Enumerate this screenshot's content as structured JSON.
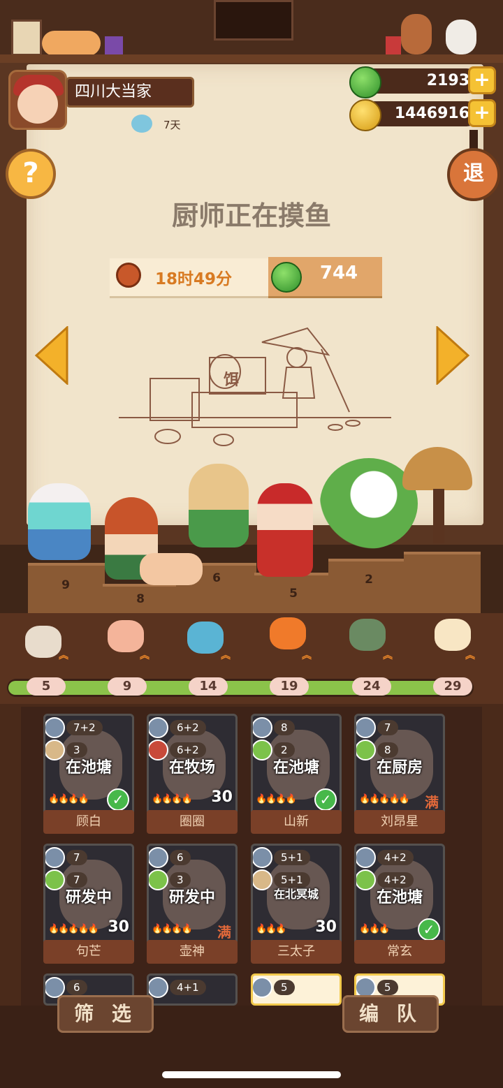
{
  "player": {
    "name": "四川大当家",
    "days": "7天"
  },
  "currency": {
    "jade": "2193",
    "coins": "1446916",
    "plus": "+"
  },
  "buttons": {
    "help": "?",
    "exit": "退",
    "filter": "筛 选",
    "team": "编 队"
  },
  "status": {
    "title": "厨师正在摸鱼",
    "timer": "18时49分",
    "reward": "744"
  },
  "sketch_sign": "饵",
  "stage_steps": [
    "9",
    "8",
    "6",
    "5",
    "2"
  ],
  "ingredient_levels": [
    "5",
    "9",
    "14",
    "19",
    "24",
    "29"
  ],
  "ingredients": [
    "shell-icon",
    "shrimp-icon",
    "fish-icon",
    "goldfish-icon",
    "crab-icon",
    "fin-icon"
  ],
  "cards": [
    {
      "name": "顾白",
      "fish": "7+2",
      "skill": "3",
      "status": "在池塘",
      "flames": "🔥🔥🔥🔥",
      "num": "",
      "check": true,
      "full": ""
    },
    {
      "name": "圈圈",
      "fish": "6+2",
      "skill": "6+2",
      "status": "在牧场",
      "flames": "🔥🔥🔥🔥",
      "num": "30",
      "check": false,
      "full": ""
    },
    {
      "name": "山新",
      "fish": "8",
      "skill": "2",
      "status": "在池塘",
      "flames": "🔥🔥🔥🔥",
      "num": "",
      "check": true,
      "full": ""
    },
    {
      "name": "刘昂星",
      "fish": "7",
      "skill": "8",
      "status": "在厨房",
      "flames": "🔥🔥🔥🔥🔥",
      "num": "",
      "check": false,
      "full": "满"
    },
    {
      "name": "句芒",
      "fish": "7",
      "skill": "7",
      "status": "研发中",
      "flames": "🔥🔥🔥🔥🔥",
      "num": "30",
      "check": false,
      "full": ""
    },
    {
      "name": "壶神",
      "fish": "6",
      "skill": "3",
      "status": "研发中",
      "flames": "🔥🔥🔥🔥",
      "num": "",
      "check": false,
      "full": "满"
    },
    {
      "name": "三太子",
      "fish": "5+1",
      "skill": "5+1",
      "status": "在北冥城",
      "flames": "🔥🔥🔥",
      "num": "30",
      "check": false,
      "full": ""
    },
    {
      "name": "常玄",
      "fish": "4+2",
      "skill": "4+2",
      "status": "在池塘",
      "flames": "🔥🔥🔥",
      "num": "",
      "check": true,
      "full": ""
    }
  ],
  "partial_cards": [
    {
      "fish": "6"
    },
    {
      "fish": "4+1"
    },
    {
      "fish": "5"
    },
    {
      "fish": "5"
    }
  ],
  "colors": {
    "accent_orange": "#d87a22",
    "jade_green": "#2f8f2a",
    "check_green": "#47b84a",
    "progress_green": "#8bc34a"
  }
}
